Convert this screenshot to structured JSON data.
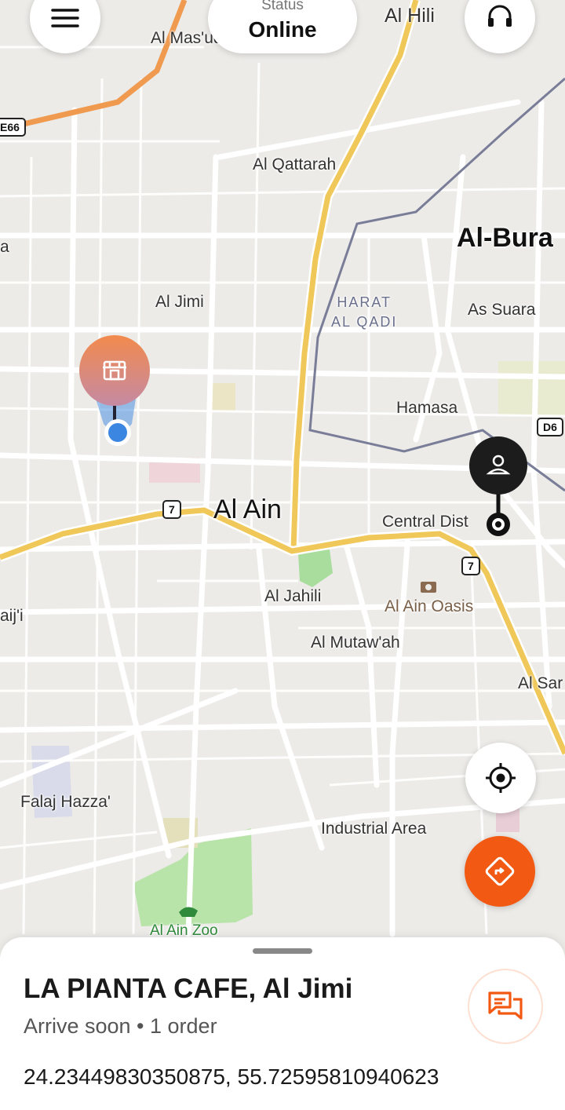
{
  "status": {
    "label": "Status",
    "value": "Online"
  },
  "map": {
    "labels": {
      "al_masudi": "Al Mas'ud",
      "al_hili": "Al Hili",
      "al_qattarah": "Al Qattarah",
      "al_buraimi": "Al-Bura",
      "harat_al_qadi": "HARAT\nAL QADI",
      "as_suara": "As Suara",
      "al_jimi": "Al Jimi",
      "hamasa": "Hamasa",
      "al_ain": "Al Ain",
      "central_district": "Central Dist",
      "al_jahili": "Al Jahili",
      "al_ain_oasis": "Al Ain Oasis",
      "al_mutawah": "Al Mutaw'ah",
      "al_sarooj": "Al Sar",
      "falaj_hazza": "Falaj Hazza'",
      "industrial_area": "Industrial Area",
      "al_ain_zoo": "Al Ain Zoo",
      "edge_a": "a",
      "edge_aij": "aij'i"
    },
    "shields": {
      "e66": "E66",
      "r7_west": "7",
      "r7_east": "7",
      "d6": "D6"
    }
  },
  "sheet": {
    "title": "LA PIANTA CAFE, Al Jimi",
    "subtitle": "Arrive soon • 1 order",
    "coordinates": "24.23449830350875, 55.72595810940623"
  },
  "colors": {
    "accent": "#f25a14",
    "route": "#f0c85a",
    "border": "#7a7d98",
    "map_bg": "#ecebe8"
  },
  "icons": {
    "menu": "menu-icon",
    "support": "headset-icon",
    "locate": "crosshair-icon",
    "navigate": "directions-icon",
    "chat": "chat-icon",
    "store": "store-icon",
    "customer": "person-icon"
  }
}
